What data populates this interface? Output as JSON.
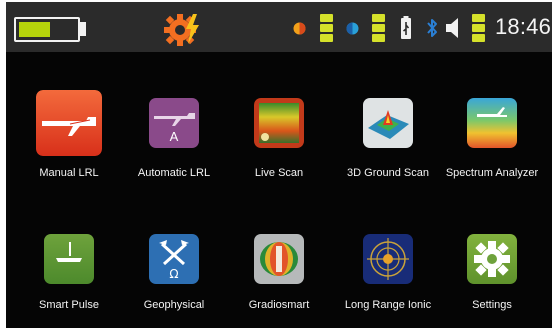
{
  "status_bar": {
    "battery_level": 0.55,
    "time": "18:46",
    "icons": [
      "battery-icon",
      "settings-alert-icon",
      "sensor-a-icon",
      "sensor-b-icon",
      "usb-icon",
      "bluetooth-icon",
      "speaker-icon",
      "volume-level-icon"
    ],
    "colors": {
      "accent_orange": "#f36f21",
      "level_green": "#d5e12a",
      "battery_green": "#b5d30b"
    }
  },
  "apps": [
    {
      "label": "Manual LRL",
      "icon": "manual-lrl-icon",
      "color": "#ef4a26"
    },
    {
      "label": "Automatic LRL",
      "icon": "automatic-lrl-icon",
      "color": "#8a4a8a"
    },
    {
      "label": "Live Scan",
      "icon": "live-scan-icon",
      "color": "#d04020"
    },
    {
      "label": "3D Ground Scan",
      "icon": "3d-ground-scan-icon",
      "color": "#c9cfd0"
    },
    {
      "label": "Spectrum Analyzer",
      "icon": "spectrum-analyzer-icon",
      "color": "#e86a2a"
    },
    {
      "label": "Smart Pulse",
      "icon": "smart-pulse-icon",
      "color": "#6c9a3c"
    },
    {
      "label": "Geophysical",
      "icon": "geophysical-icon",
      "color": "#2d6fb3"
    },
    {
      "label": "Gradiosmart",
      "icon": "gradiosmart-icon",
      "color": "#b5b8b9"
    },
    {
      "label": "Long Range Ionic",
      "icon": "long-range-ionic-icon",
      "color": "#1a2d7a"
    },
    {
      "label": "Settings",
      "icon": "settings-icon",
      "color": "#7aa83a"
    }
  ]
}
